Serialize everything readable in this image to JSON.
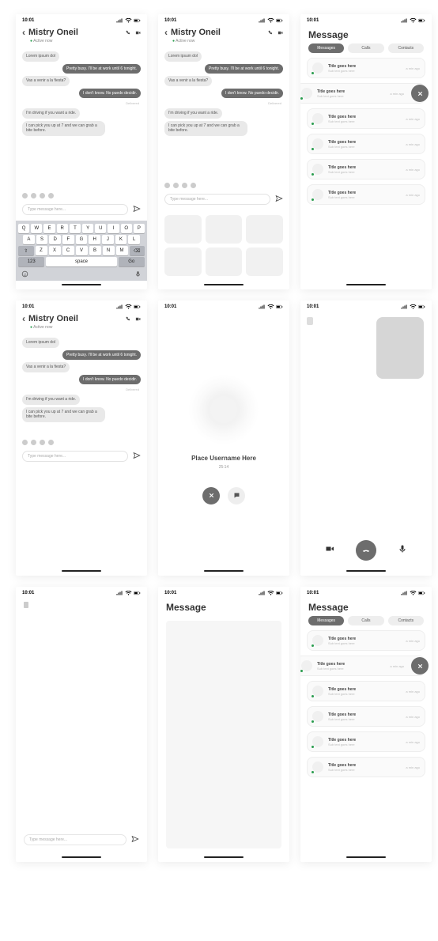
{
  "status": {
    "time": "10:01"
  },
  "chat": {
    "contact": "Mistry Oneil",
    "status": "Active now",
    "messages": {
      "m1": "Lorem ipsum dol",
      "m2": "Pretty busy. I'll be at work until 6 tonight.",
      "m3": "Vas a venir a la fiesta?",
      "m4": "I don't know. No puedo decidir.",
      "m5": "I'm driving if you want a ride.",
      "m6": "I can pick you up at 7 and we can grab a bite before.",
      "delivered": "Delivered"
    },
    "input_placeholder": "Type message here..."
  },
  "keyboard": {
    "r1": [
      "Q",
      "W",
      "E",
      "R",
      "T",
      "Y",
      "U",
      "I",
      "O",
      "P"
    ],
    "r2": [
      "A",
      "S",
      "D",
      "F",
      "G",
      "H",
      "J",
      "K",
      "L"
    ],
    "r3_shift": "⇧",
    "r3": [
      "Z",
      "X",
      "C",
      "V",
      "B",
      "N",
      "M"
    ],
    "r3_del": "⌫",
    "r4_123": "123",
    "r4_space": "space",
    "r4_go": "Go"
  },
  "messages_screen": {
    "title": "Message",
    "tabs": {
      "messages": "Messages",
      "calls": "Calls",
      "contacts": "Contacts"
    },
    "item": {
      "title": "Title goes here",
      "sub": "Sub text goes here",
      "time": "a min ago"
    }
  },
  "call_screen": {
    "placeholder": "Place Username Here",
    "time": "25:14"
  }
}
